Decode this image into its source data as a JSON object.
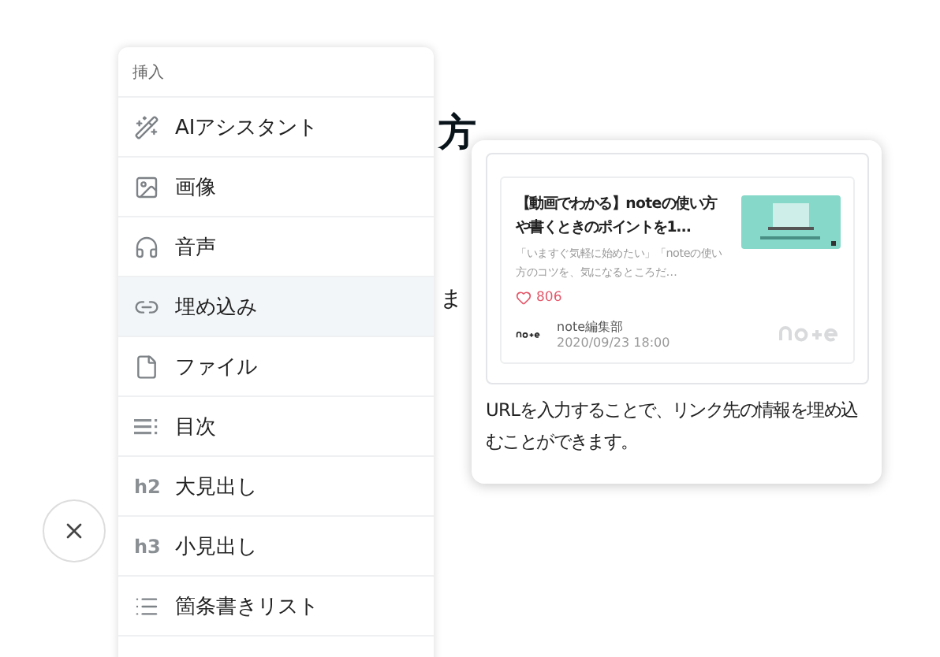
{
  "background": {
    "heading": "方",
    "text": "ま"
  },
  "menu": {
    "header": "挿入",
    "items": [
      {
        "label": "AIアシスタント",
        "selected": false
      },
      {
        "label": "画像",
        "selected": false
      },
      {
        "label": "音声",
        "selected": false
      },
      {
        "label": "埋め込み",
        "selected": true
      },
      {
        "label": "ファイル",
        "selected": false
      },
      {
        "label": "目次",
        "selected": false
      },
      {
        "label": "大見出し",
        "glyph": "h2",
        "selected": false
      },
      {
        "label": "小見出し",
        "glyph": "h3",
        "selected": false
      },
      {
        "label": "箇条書きリスト",
        "selected": false
      }
    ]
  },
  "preview": {
    "card": {
      "title": "【動画でわかる】noteの使い方や書くときのポイントを1…",
      "description": "「いますぐ気軽に始めたい」「noteの使い方のコツを、気になるところだ…",
      "likes": "806",
      "author": "note編集部",
      "date": "2020/09/23 18:00"
    },
    "caption": "URLを入力することで、リンク先の情報を埋め込むことができます。"
  }
}
